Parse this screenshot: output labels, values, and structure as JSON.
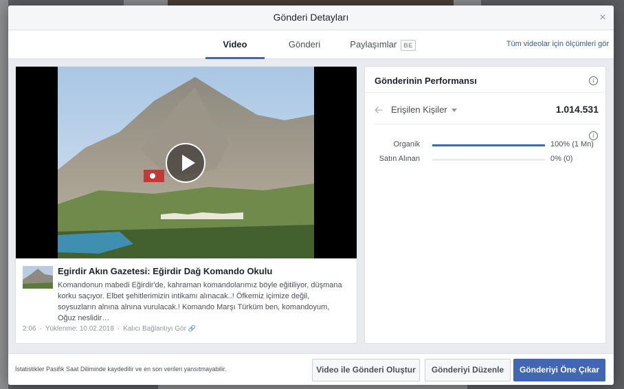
{
  "modal": {
    "title": "Gönderi Detayları",
    "close_glyph": "×"
  },
  "tabs": [
    {
      "label": "Video",
      "active": true
    },
    {
      "label": "Gönderi",
      "active": false
    },
    {
      "label": "Paylaşımlar",
      "badge": "BE",
      "active": false
    }
  ],
  "all_videos_link": "Tüm videolar için ölçümleri gör",
  "video": {
    "title": "Egirdir Akın Gazetesi: Eğirdir Dağ Komando Okulu",
    "description": "Komandonun mabedi Eğirdir'de, kahraman komandolarımız böyle eğitiliyor, düşmana korku saçıyor. Elbet şehitlerimizin intikamı alınacak..! Öfkemiz içimize değil, soysuzların alnına alnına vurulacak.! Komando Marşı Türküm ben, komandoyum, Oğuz neslidir…",
    "duration": "2:06",
    "uploaded": "Yüklenme: 10.02.2018",
    "permalink": "Kalıcı Bağlantıyı Gör"
  },
  "performance": {
    "title": "Gönderinin Performansı",
    "metric_label": "Erişilen Kişiler",
    "metric_value": "1.014.531",
    "rows": [
      {
        "label": "Organik",
        "value": "100% (1 Mn)",
        "fraction": 1.0
      },
      {
        "label": "Satın Alınan",
        "value": "0% (0)",
        "fraction": 0.0
      }
    ]
  },
  "footer": {
    "note": "İstatistikler Pasifik Saat Diliminde kaydedilir ve en son verileri yansıtmayabilir.",
    "buttons": {
      "create": "Video ile Gönderi Oluştur",
      "edit": "Gönderiyi Düzenle",
      "boost": "Gönderiyi Öne Çıkar"
    }
  },
  "colors": {
    "accent": "#4267b2",
    "link": "#365899"
  }
}
